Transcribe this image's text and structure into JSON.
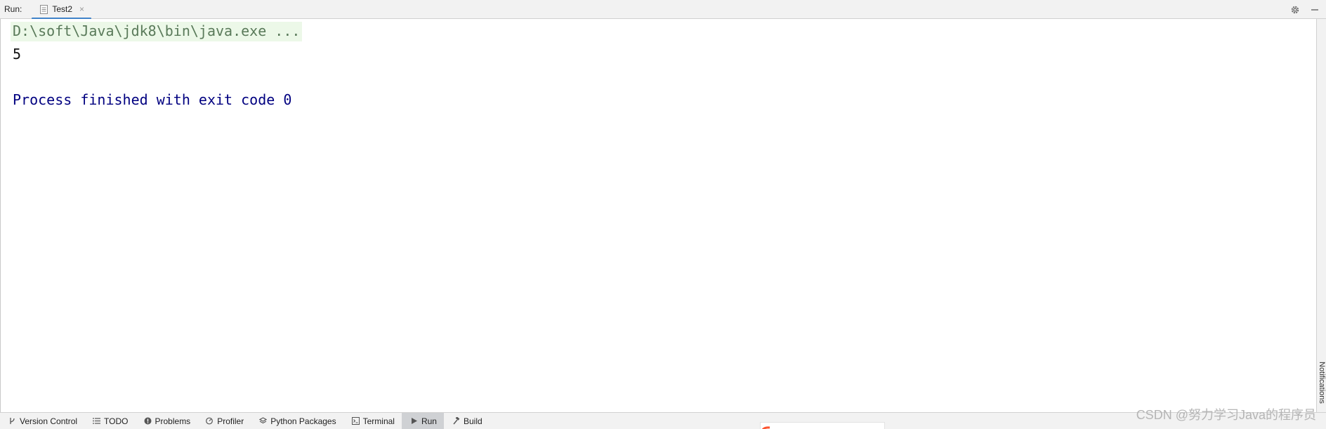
{
  "header": {
    "run_label": "Run:",
    "tab": {
      "label": "Test2",
      "close": "×"
    }
  },
  "console": {
    "command": "D:\\soft\\Java\\jdk8\\bin\\java.exe ...",
    "output": "5",
    "exit_message": "Process finished with exit code 0"
  },
  "right_strip": {
    "label": "Notifications"
  },
  "bottom_bar": {
    "items": [
      {
        "label": "Version Control",
        "icon": "branch-icon"
      },
      {
        "label": "TODO",
        "icon": "list-icon"
      },
      {
        "label": "Problems",
        "icon": "problems-icon"
      },
      {
        "label": "Profiler",
        "icon": "profiler-icon"
      },
      {
        "label": "Python Packages",
        "icon": "layers-icon"
      },
      {
        "label": "Terminal",
        "icon": "terminal-icon"
      },
      {
        "label": "Run",
        "icon": "play-icon",
        "active": true
      },
      {
        "label": "Build",
        "icon": "hammer-icon"
      }
    ]
  },
  "watermark": "CSDN @努力学习Java的程序员",
  "colors": {
    "accent": "#4083c9",
    "exit_text": "#000080",
    "command_bg": "#ecf8e8",
    "command_text": "#5a7a5a"
  }
}
